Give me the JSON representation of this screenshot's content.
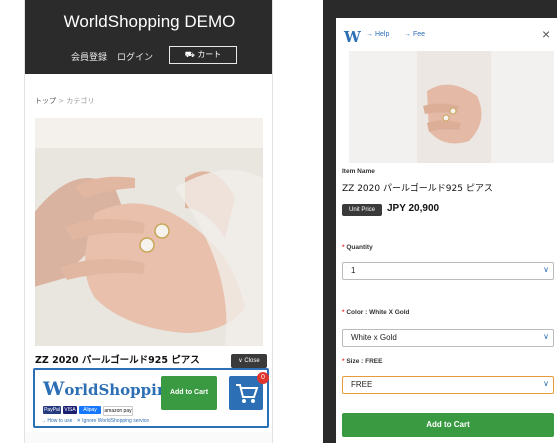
{
  "left": {
    "title": "WorldShopping DEMO",
    "nav": {
      "register": "会員登録",
      "login": "ログイン",
      "cart": "カート"
    },
    "breadcrumb": {
      "home": "トップ",
      "sep": ">",
      "current": "カテゴリ"
    },
    "product_name": "ZZ 2020 パールゴールド925 ピアス",
    "close_label": "Close",
    "worldshopping": {
      "logo_text": "orldShopping",
      "logo_w": "W",
      "add_to_cart": "Add to Cart",
      "cart_count": "0",
      "payments": [
        "PayPal",
        "VISA",
        "Alipay",
        "amazon pay"
      ],
      "how_to_use": "→ How to use",
      "ignore": "✕ Ignore WorldShopping service"
    }
  },
  "modal": {
    "logo": "W",
    "help": "→ Help",
    "fee": "→ Fee",
    "close": "×",
    "item_name_label": "Item Name",
    "item_name": "ZZ 2020 パールゴールド925 ピアス",
    "unit_price_label": "Unit Price",
    "price": "JPY 20,900",
    "quantity_label": "Quantity",
    "quantity_value": "1",
    "color_label": "Color : White X Gold",
    "color_value": "White x Gold",
    "size_label": "Size : FREE",
    "size_value": "FREE",
    "add_to_cart": "Add to Cart"
  },
  "colors": {
    "brand_blue": "#2d6fb5",
    "green": "#3a9a42",
    "header_dark": "#2b2b2b",
    "required_red": "#e0342e"
  },
  "icons": [
    "cart-icon",
    "close-icon",
    "chevron-down-icon",
    "shopping-cart-icon"
  ]
}
